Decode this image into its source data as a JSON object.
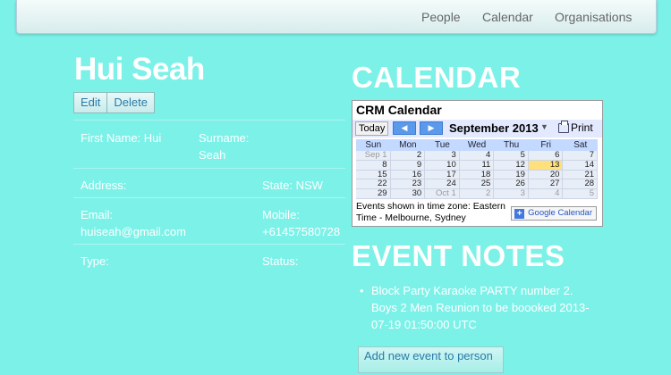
{
  "nav": {
    "items": [
      "People",
      "Calendar",
      "Organisations"
    ]
  },
  "person": {
    "name": "Hui Seah",
    "edit_label": "Edit",
    "delete_label": "Delete",
    "first_name_label": "First Name:",
    "first_name": "Hui",
    "surname_label": "Surname:",
    "surname": "Seah",
    "address_label": "Address:",
    "address": "",
    "state_label": "State:",
    "state": "NSW",
    "email_label": "Email:",
    "email": "huiseah@gmail.com",
    "mobile_label": "Mobile:",
    "mobile": "+61457580728",
    "type_label": "Type:",
    "type": "",
    "status_label": "Status:",
    "status": ""
  },
  "calendar_section": {
    "heading": "CALENDAR",
    "widget": {
      "title": "CRM Calendar",
      "today_label": "Today",
      "prev_icon": "left-arrow-icon",
      "next_icon": "right-arrow-icon",
      "month": "September 2013",
      "print_label": "Print",
      "days_of_week": [
        "Sun",
        "Mon",
        "Tue",
        "Wed",
        "Thu",
        "Fri",
        "Sat"
      ],
      "weeks": [
        [
          "Sep 1",
          "2",
          "3",
          "4",
          "5",
          "6",
          "7"
        ],
        [
          "8",
          "9",
          "10",
          "11",
          "12",
          "13",
          "14"
        ],
        [
          "15",
          "16",
          "17",
          "18",
          "19",
          "20",
          "21"
        ],
        [
          "22",
          "23",
          "24",
          "25",
          "26",
          "27",
          "28"
        ],
        [
          "29",
          "30",
          "Oct 1",
          "2",
          "3",
          "4",
          "5"
        ]
      ],
      "today_date": "13",
      "timezone_note": "Events shown in time zone: Eastern Time - Melbourne, Sydney",
      "google_label": "Google",
      "google_calendar_word": "Calendar",
      "colors": {
        "header_bar": "#e3e9ff",
        "dow_bar": "#c3d9ff",
        "today": "#ffe07a",
        "nav_arrows": "#5b9aea"
      }
    }
  },
  "event_notes": {
    "heading": "EVENT NOTES",
    "items": [
      "Block Party Karaoke PARTY number 2. Boys 2 Men Reunion to be boooked 2013-07-19 01:50:00 UTC"
    ],
    "add_label": "Add new event to person"
  },
  "colors": {
    "page_bg": "#7cf1e8",
    "link": "#2a7aa8"
  }
}
